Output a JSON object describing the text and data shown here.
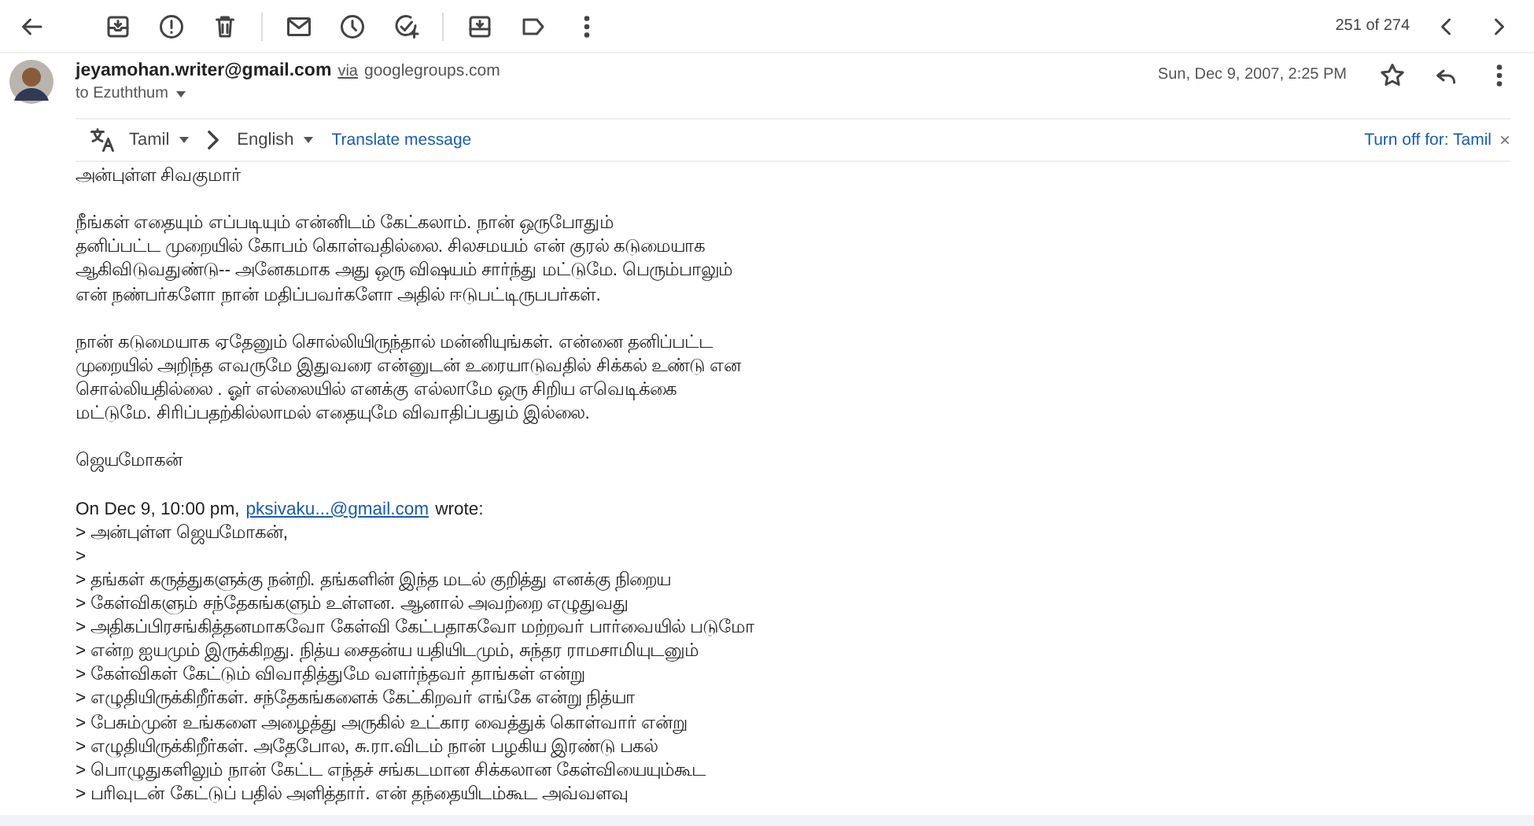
{
  "toolbar": {
    "counter": "251 of 274"
  },
  "message": {
    "sender": "jeyamohan.writer@gmail.com",
    "via_label": "via",
    "via_domain": "googlegroups.com",
    "recipient": "to Ezuththum",
    "date": "Sun, Dec 9, 2007, 2:25 PM",
    "starred": false
  },
  "translate_bar": {
    "source_language": "Tamil",
    "target_language": "English",
    "action": "Translate message",
    "turn_off": "Turn off for: Tamil",
    "close": "×"
  },
  "body": {
    "paragraphs": [
      [
        "அன்புள்ள சிவகுமார்"
      ],
      [
        "நீங்கள் எதையும் எப்படியும் என்னிடம் கேட்கலாம். நான் ஒருபோதும்",
        "தனிப்பட்ட முறையில் கோபம் கொள்வதில்லை. சிலசமயம் என் குரல் கடுமையாக",
        "ஆகிவிடுவதுண்டு-- அனேகமாக அது ஒரு விஷயம் சார்ந்து மட்டுமே. பெரும்பாலும்",
        "என் நண்பர்களோ நான் மதிப்பவர்களோ அதில் ஈடுபட்டிருபபர்கள்."
      ],
      [
        "நான் கடுமையாக ஏதேனும் சொல்லியிருந்தால் மன்னியுங்கள். என்னை தனிப்பட்ட",
        "முறையில் அறிந்த எவருமே இதுவரை என்னுடன் உரையாடுவதில் சிக்கல் உண்டு என",
        "சொல்லியதில்லை . ஓர் எல்லையில் எனக்கு எல்லாமே ஒரு சிறிய எவெடிக்கை",
        "மட்டுமே. சிரிப்பதற்கில்லாமல் எதையுமே விவாதிப்பதும் இல்லை."
      ],
      [
        "ஜெயமோகன்"
      ]
    ],
    "quote_header": {
      "before": "On Dec 9, 10:00 pm,",
      "link": "pksivaku...@gmail.com",
      "after": "wrote:"
    },
    "quoted_lines": [
      "> அன்புள்ள ஜெயமோகன்,",
      ">",
      "> தங்கள் கருத்துகளுக்கு நன்றி. தங்களின் இந்த மடல் குறித்து எனக்கு நிறைய",
      "> கேள்விகளும் சந்தேகங்களும் உள்ளன. ஆனால் அவற்றை எழுதுவது",
      "> அதிகப்பிரசங்கித்தனமாகவோ கேள்வி கேட்பதாகவோ மற்றவர் பார்வையில் படுமோ",
      "> என்ற ஐயமும் இருக்கிறது. நித்ய சைதன்ய யதியிடமும், சுந்தர ராமசாமியுடனும்",
      "> கேள்விகள் கேட்டும் விவாதித்துமே வளர்ந்தவர் தாங்கள் என்று",
      "> எழுதியிருக்கிறீர்கள். சந்தேகங்களைக் கேட்கிறவர் எங்கே என்று நித்யா",
      "> பேசும்முன் உங்களை அழைத்து அருகில் உட்கார வைத்துக் கொள்வார் என்று",
      "> எழுதியிருக்கிறீர்கள். அதேபோல, சு.ரா.விடம் நான் பழகிய இரண்டு பகல்",
      "> பொழுதுகளிலும் நான் கேட்ட எந்தச் சங்கடமான சிக்கலான கேள்வியையும்கூட",
      "> பரிவுடன் கேட்டுப் பதில் அளித்தார். என் தந்தையிடம்கூட அவ்வளவு"
    ]
  }
}
